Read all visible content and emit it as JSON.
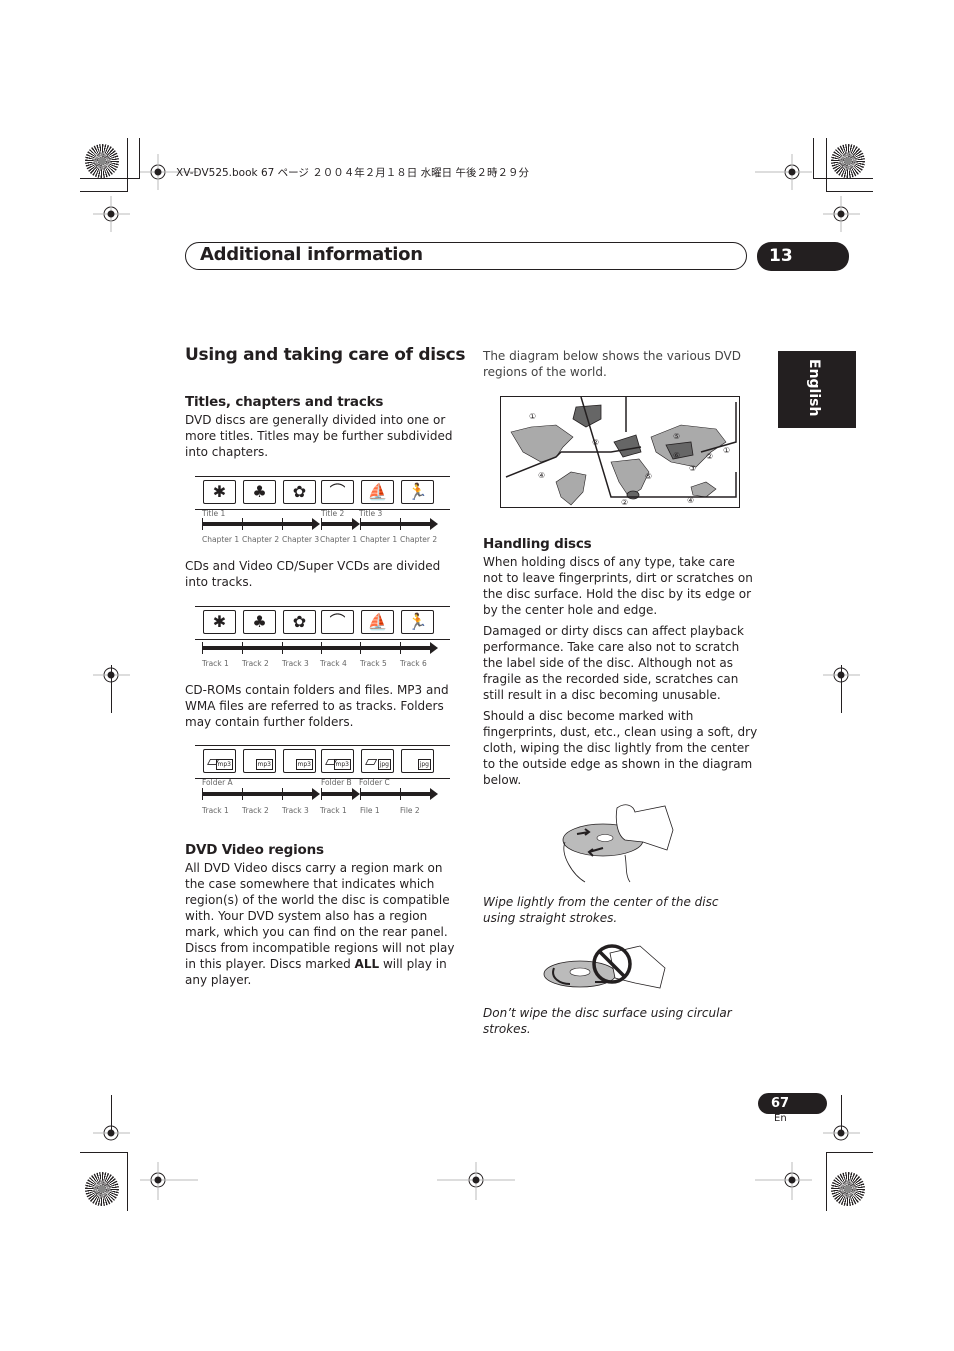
{
  "print_header": "XV-DV525.book  67 ページ  ２００４年２月１８日  水曜日  午後２時２９分",
  "header": {
    "title": "Additional information",
    "chapter_number": "13"
  },
  "language_tab": "English",
  "section_title": "Using and taking care of discs",
  "titles_chapters": {
    "heading": "Titles, chapters and tracks",
    "intro": "DVD discs are generally divided into one or more titles. Titles may be further subdivided into chapters.",
    "diagram1": {
      "icons": [
        "leaf-icon",
        "tree-icon",
        "flower-icon",
        "bird-icon",
        "windsurfer-icon",
        "skater-icon"
      ],
      "top_labels": [
        "Title 1",
        "Title 2",
        "Title 3"
      ],
      "bottom_labels": [
        "Chapter 1",
        "Chapter 2",
        "Chapter 3",
        "Chapter 1",
        "Chapter 1",
        "Chapter 2"
      ]
    },
    "cd_text": "CDs and Video CD/Super VCDs are divided into tracks.",
    "diagram2": {
      "icons": [
        "leaf-icon",
        "tree-icon",
        "flower-icon",
        "bird-icon",
        "windsurfer-icon",
        "skater-icon"
      ],
      "bottom_labels": [
        "Track 1",
        "Track 2",
        "Track 3",
        "Track 4",
        "Track 5",
        "Track 6"
      ]
    },
    "cdrom_text": "CD-ROMs contain folders and files. MP3 and WMA files are referred to as tracks. Folders may contain further folders.",
    "diagram3": {
      "top_labels": [
        "Folder A",
        "Folder B",
        "Folder C"
      ],
      "bottom_labels": [
        "Track 1",
        "Track 2",
        "Track 3",
        "Track 1",
        "File 1",
        "File 2"
      ],
      "file_tags": [
        "mp3",
        "mp3",
        "mp3",
        "mp3",
        "jpg",
        "jpg"
      ]
    }
  },
  "dvd_regions": {
    "heading": "DVD Video regions",
    "body_before_bold": "All DVD Video discs carry a region mark on the case somewhere that indicates which region(s) of the world the disc is compatible with. Your DVD system also has a region mark, which you can find on the rear panel. Discs from incompatible regions will not play in this player. Discs marked ",
    "bold": "ALL",
    "body_after_bold": " will play in any player.",
    "map_intro": "The diagram below shows the various DVD regions of the world.",
    "map_region_marks": [
      "①",
      "②",
      "④",
      "②",
      "⑤",
      "⑥",
      "⑤",
      "②",
      "①",
      "③",
      "④"
    ]
  },
  "handling": {
    "heading": "Handling discs",
    "para1": "When holding discs of any type, take care not to leave fingerprints, dirt or scratches on the disc surface. Hold the disc by its edge or by the center hole and edge.",
    "para2": "Damaged or dirty discs can affect playback performance. Take care also not to scratch the label side of the disc. Although not as fragile as the recorded side, scratches can still result in a disc becoming unusable.",
    "para3": "Should a disc become marked with fingerprints, dust, etc., clean using a soft, dry cloth, wiping the disc lightly from the center to the outside edge as shown in the diagram below.",
    "caption1": "Wipe lightly from the center of the disc using straight strokes.",
    "caption2": "Don’t wipe the disc surface using circular strokes."
  },
  "footer": {
    "page_number": "67",
    "language_code": "En"
  }
}
